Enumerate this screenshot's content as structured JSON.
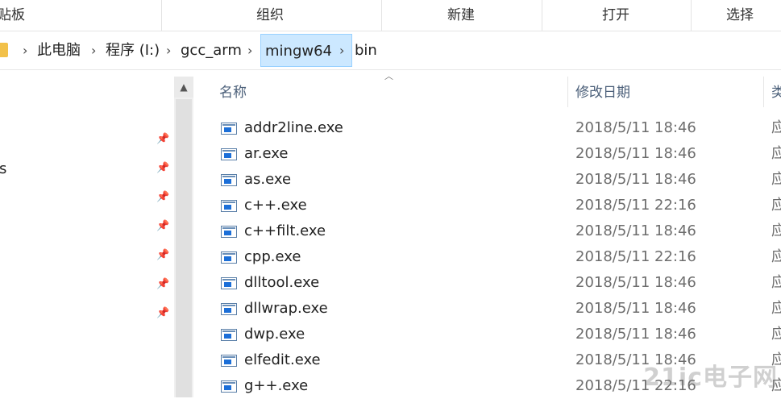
{
  "ribbon": {
    "groups": [
      "剪贴板",
      "组织",
      "新建",
      "打开",
      "选择"
    ]
  },
  "address": {
    "crumbs": [
      "此电脑",
      "程序 (I:)",
      "gcc_arm",
      "mingw64",
      "bin"
    ],
    "active_crumb": "mingw64"
  },
  "nav": {
    "fragment": "s",
    "pin_icon": "pin-icon"
  },
  "columns": {
    "name": "名称",
    "date": "修改日期",
    "type": "类"
  },
  "files": [
    {
      "name": "addr2line.exe",
      "date": "2018/5/11 18:46",
      "type": "应"
    },
    {
      "name": "ar.exe",
      "date": "2018/5/11 18:46",
      "type": "应"
    },
    {
      "name": "as.exe",
      "date": "2018/5/11 18:46",
      "type": "应"
    },
    {
      "name": "c++.exe",
      "date": "2018/5/11 22:16",
      "type": "应"
    },
    {
      "name": "c++filt.exe",
      "date": "2018/5/11 18:46",
      "type": "应"
    },
    {
      "name": "cpp.exe",
      "date": "2018/5/11 22:16",
      "type": "应"
    },
    {
      "name": "dlltool.exe",
      "date": "2018/5/11 18:46",
      "type": "应"
    },
    {
      "name": "dllwrap.exe",
      "date": "2018/5/11 18:46",
      "type": "应"
    },
    {
      "name": "dwp.exe",
      "date": "2018/5/11 18:46",
      "type": "应"
    },
    {
      "name": "elfedit.exe",
      "date": "2018/5/11 18:46",
      "type": "应"
    },
    {
      "name": "g++.exe",
      "date": "2018/5/11 22:16",
      "type": "应"
    }
  ],
  "watermark": "21ic电子网",
  "colors": {
    "active_crumb_bg": "#cce8ff",
    "header_text": "#4c607a",
    "exe_icon_blue": "#1c6fd8"
  }
}
